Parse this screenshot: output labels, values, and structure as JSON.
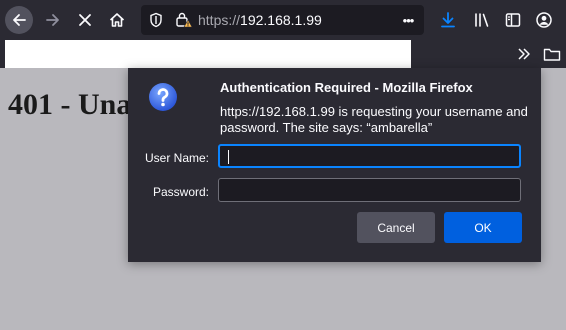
{
  "browser": {
    "url_scheme": "https://",
    "url_host": "192.168.1.99",
    "page_actions_label": "•••",
    "colors": {
      "toolbar": "#2b2a33",
      "urlbar": "#1c1b22",
      "accent": "#0a84ff",
      "download": "#0a84ff"
    },
    "icons": [
      "back-arrow-icon",
      "forward-arrow-icon",
      "stop-icon",
      "home-icon",
      "shield-icon",
      "insecure-lock-icon",
      "download-icon",
      "library-icon",
      "sidebar-icon",
      "account-icon",
      "overflow-chevron-icon",
      "folder-icon"
    ]
  },
  "page": {
    "heading": "401 - Una"
  },
  "dialog": {
    "title": "Authentication Required - Mozilla Firefox",
    "message": "https://192.168.1.99 is requesting your username and password. The site says: “ambarella”",
    "username_label": "User Name:",
    "username_value": "",
    "password_label": "Password:",
    "password_value": "",
    "cancel_label": "Cancel",
    "ok_label": "OK",
    "colors": {
      "background": "#2b2a33",
      "ok_button": "#0060df",
      "cancel_button": "#52525e",
      "focus_ring": "#0a84ff"
    }
  }
}
